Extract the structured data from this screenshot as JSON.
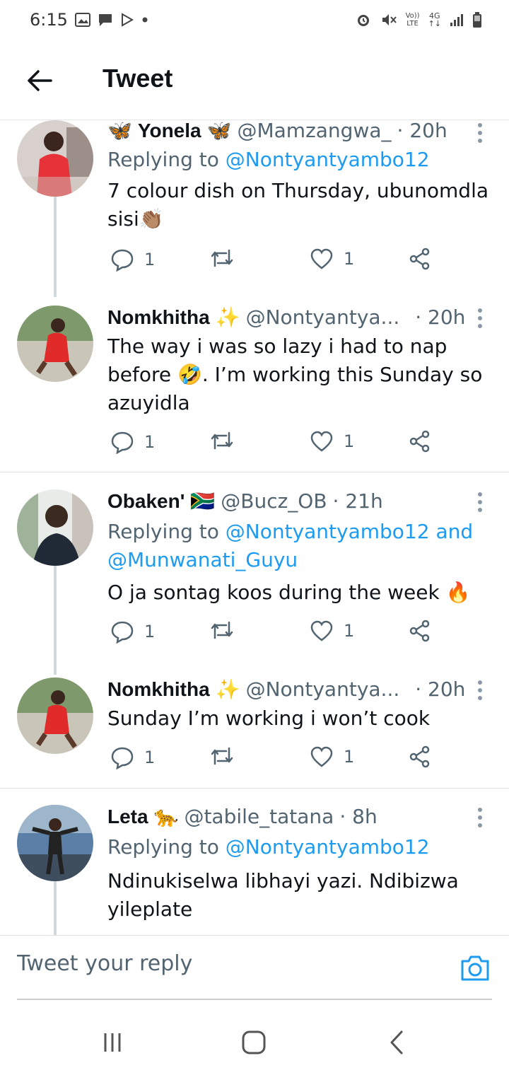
{
  "status_bar": {
    "time": "6:15",
    "left_icons": [
      "image-icon",
      "message-icon",
      "play-store-icon",
      "dot-icon"
    ],
    "right_icons": [
      "alarm-icon",
      "mute-icon",
      "volte-icon",
      "4g-icon",
      "signal-icon",
      "battery-icon"
    ],
    "volte_label": "Vo)) LTE",
    "network_label": "4G"
  },
  "header": {
    "title": "Tweet"
  },
  "tweets": [
    {
      "name": "Yonela",
      "name_emoji_left": "🦋",
      "name_emoji_right": "🦋",
      "handle": "@Mamzangwa_",
      "time": "· 20h",
      "replying_prefix": "Replying to ",
      "replying_to": "@Nontyantyambo12",
      "text": "7 colour dish on Thursday, ubunomdla sisi👏🏽",
      "replies": "1",
      "likes": "1"
    },
    {
      "name": "Nomkhitha",
      "name_emoji_right": "✨",
      "handle": "@Nontyantya...",
      "time": "· 20h",
      "text": "The way i was so lazy i had to nap before 🤣. I’m working this Sunday so azuyidla",
      "replies": "1",
      "likes": "1"
    },
    {
      "name": "Obaken'",
      "name_emoji_right": "🇿🇦",
      "handle": "@Bucz_OB",
      "time": "· 21h",
      "replying_prefix": "Replying to ",
      "replying_to": "@Nontyantyambo12 and @Munwanati_Guyu",
      "text": "O ja sontag koos during the week 🔥",
      "replies": "1",
      "likes": "1"
    },
    {
      "name": "Nomkhitha",
      "name_emoji_right": "✨",
      "handle": "@Nontyantya...",
      "time": "· 20h",
      "text": "Sunday I’m working i won’t cook",
      "replies": "1",
      "likes": "1"
    },
    {
      "name": "Leta",
      "name_emoji_right": "🐆",
      "handle": "@tabile_tatana",
      "time": "· 8h",
      "replying_prefix": "Replying to ",
      "replying_to": "@Nontyantyambo12",
      "text": "Ndinukiselwa libhayi yazi. Ndibizwa yileplate"
    }
  ],
  "reply_bar": {
    "placeholder": "Tweet your reply"
  },
  "colors": {
    "accent": "#1d9bf0",
    "secondary_text": "#536471",
    "thread_line": "#cfd9de"
  }
}
